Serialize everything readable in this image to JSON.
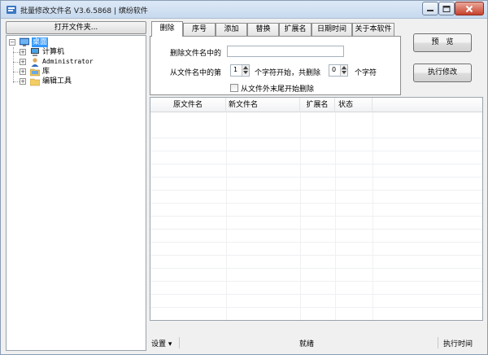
{
  "window": {
    "title": "批量修改文件名 V3.6.5868 | 缤纷软件"
  },
  "left_pane": {
    "open_folder_label": "打开文件夹...",
    "tree": [
      {
        "label": "桌面",
        "expander": "−",
        "selected": true,
        "icon": "desktop-icon"
      },
      {
        "label": "计算机",
        "expander": "+",
        "icon": "computer-icon"
      },
      {
        "label": "Administrator",
        "expander": "+",
        "icon": "user-folder-icon"
      },
      {
        "label": "库",
        "expander": "+",
        "icon": "library-icon"
      },
      {
        "label": "编辑工具",
        "expander": "+",
        "icon": "folder-icon"
      }
    ]
  },
  "tabs": [
    "删除",
    "序号",
    "添加",
    "替换",
    "扩展名",
    "日期时间",
    "关于本软件"
  ],
  "active_tab": "删除",
  "delete_panel": {
    "delete_in_name_label": "删除文件名中的",
    "delete_in_name_value": "",
    "from_position_label": "从文件名中的第",
    "start_value": "1",
    "chars_start_label": "个字符开始，共删除",
    "count_value": "0",
    "chars_label": "个字符",
    "from_end_label": "从文件外末尾开始删除"
  },
  "actions": {
    "preview_label": "预　览",
    "execute_label": "执行修改"
  },
  "list": {
    "columns": [
      "原文件名",
      "新文件名",
      "扩展名",
      "状态"
    ]
  },
  "statusbar": {
    "settings_label": "设置 ▾",
    "status_text": "就绪",
    "exec_time_label": "执行时间"
  },
  "colors": {
    "selection": "#3399ff",
    "window_bg": "#f0f0f0",
    "close_button": "#c7422d"
  }
}
